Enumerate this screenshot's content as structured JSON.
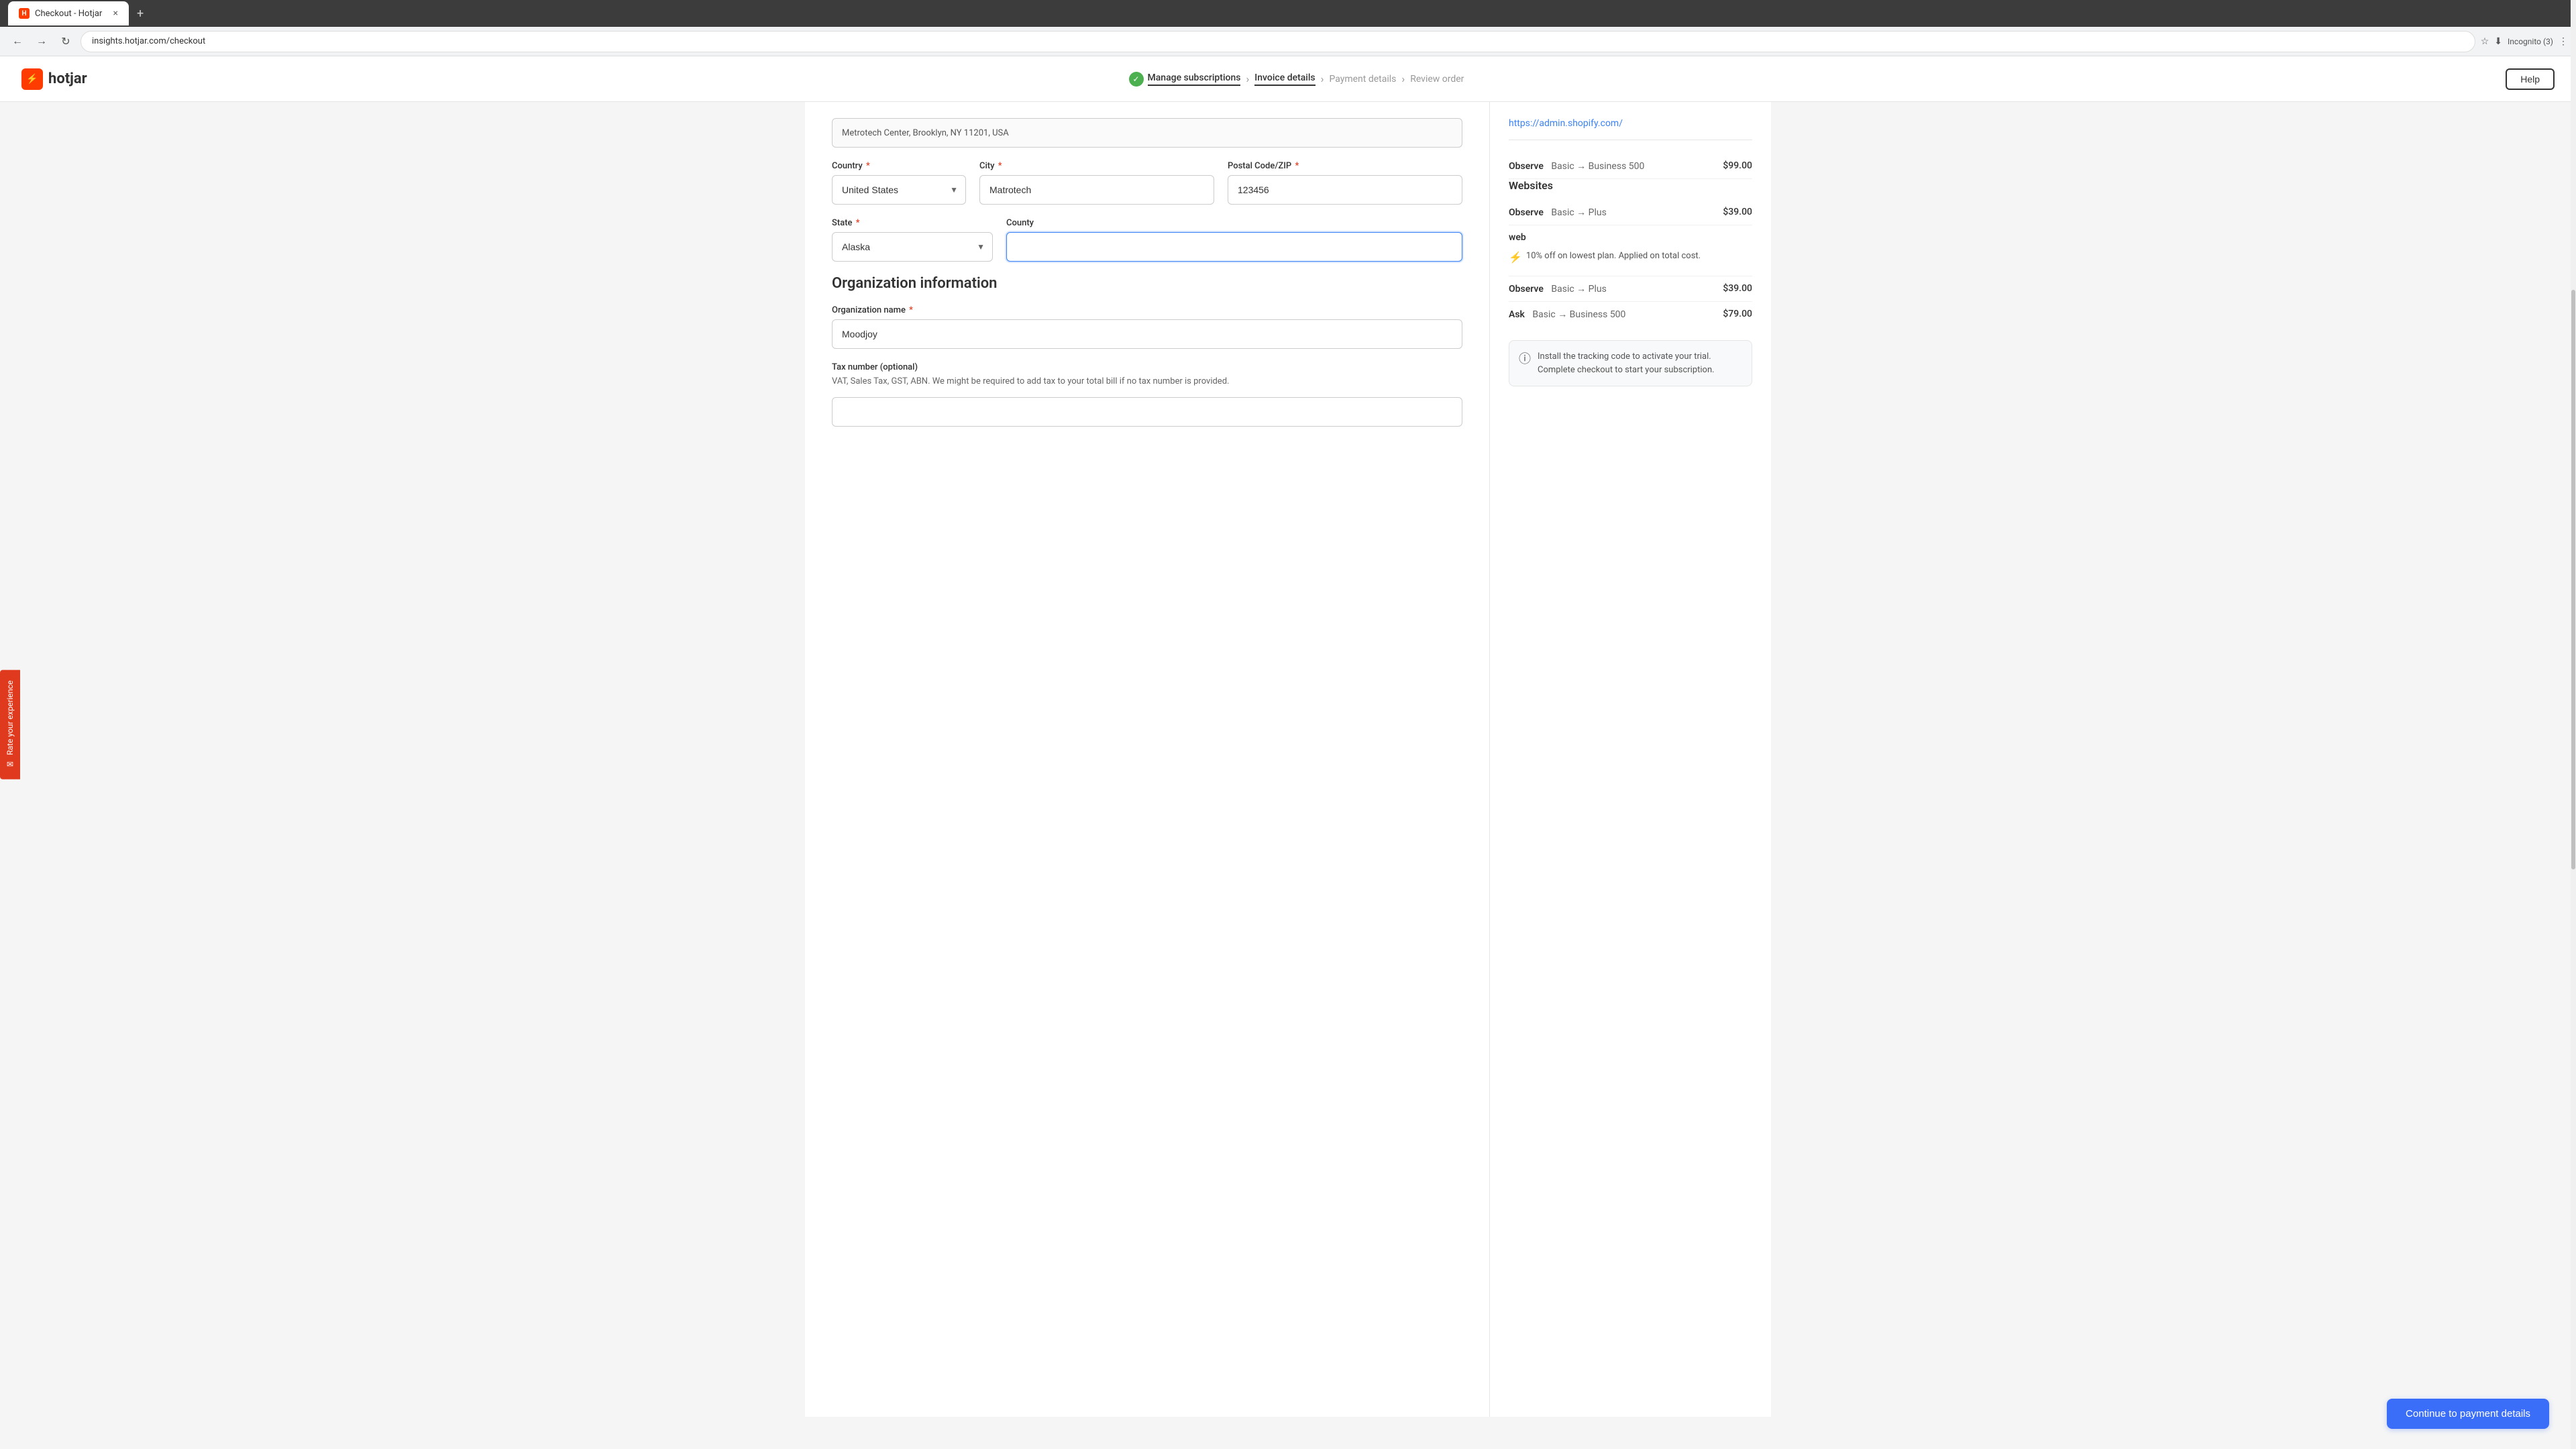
{
  "browser": {
    "tab_title": "Checkout - Hotjar",
    "tab_close": "×",
    "tab_new": "+",
    "url": "insights.hotjar.com/checkout",
    "nav_back": "←",
    "nav_forward": "→",
    "nav_refresh": "↻",
    "nav_profile": "Incognito (3)"
  },
  "header": {
    "logo_text": "hotjar",
    "help_label": "Help"
  },
  "steps": [
    {
      "label": "Manage subscriptions",
      "status": "done"
    },
    {
      "label": "Invoice details",
      "status": "active"
    },
    {
      "label": "Payment details",
      "status": "inactive"
    },
    {
      "label": "Review order",
      "status": "inactive"
    }
  ],
  "form": {
    "address_value": "Metrotech Center, Brooklyn, NY 11201, USA",
    "country_label": "Country",
    "country_value": "United States",
    "city_label": "City",
    "city_value": "Matrotech",
    "postal_label": "Postal Code/ZIP",
    "postal_value": "123456",
    "state_label": "State",
    "state_value": "Alaska",
    "county_label": "County",
    "county_value": "",
    "section_title": "Organization information",
    "org_name_label": "Organization name",
    "org_name_value": "Moodjoy",
    "tax_label": "Tax number (optional)",
    "tax_hint": "VAT, Sales Tax, GST, ABN. We might be required to add tax to your total bill if no tax number is provided.",
    "tax_value": "",
    "required_marker": "*"
  },
  "order_summary": {
    "url": "https://admin.shopify.com/",
    "section1_title": "",
    "items": [
      {
        "label": "Observe",
        "description": "Basic → Business 500",
        "price": "$99.00"
      }
    ],
    "websites_title": "Websites",
    "website_items": [
      {
        "label": "Observe",
        "description": "Basic → Plus",
        "price": "$39.00"
      },
      {
        "label": "web",
        "description": "",
        "price": ""
      }
    ],
    "discount_text": "10% off on lowest plan. Applied on total cost.",
    "more_items": [
      {
        "label": "Observe",
        "description": "Basic → Plus",
        "price": "$39.00"
      },
      {
        "label": "Ask",
        "description": "Basic → Business 500",
        "price": "$79.00"
      }
    ],
    "install_notice": "Install the tracking code to activate your trial. Complete checkout to start your subscription.",
    "continue_btn": "Continue to payment details"
  },
  "rate_sidebar": {
    "text": "Rate your experience"
  }
}
